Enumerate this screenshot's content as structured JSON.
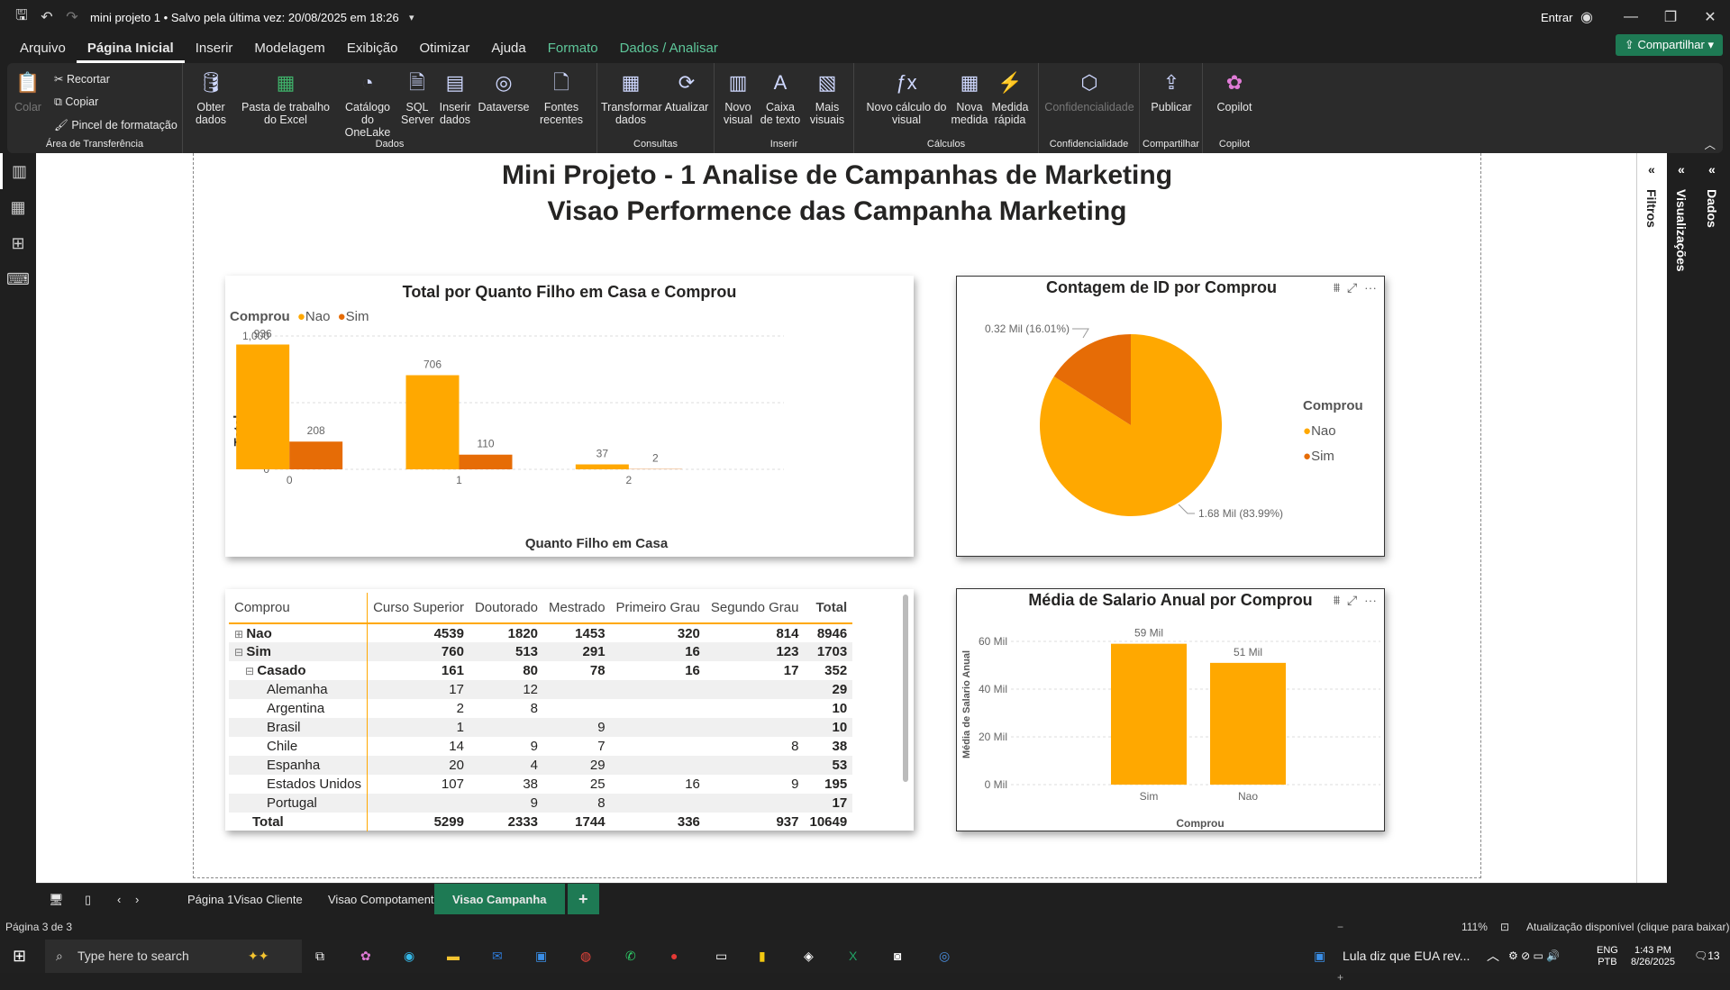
{
  "window": {
    "title": "mini projeto 1 • Salvo pela última vez: 20/08/2025 em 18:26",
    "signin": "Entrar"
  },
  "menu": [
    "Arquivo",
    "Página Inicial",
    "Inserir",
    "Modelagem",
    "Exibição",
    "Otimizar",
    "Ajuda",
    "Formato",
    "Dados / Analisar"
  ],
  "share": "Compartilhar",
  "ribbon": {
    "clipboard": {
      "colar": "Colar",
      "recortar": "Recortar",
      "copiar": "Copiar",
      "pincel": "Pincel de formatação",
      "label": "Área de Transferência"
    },
    "dados": {
      "items": [
        "Obter dados",
        "Pasta de trabalho do Excel",
        "Catálogo do OneLake",
        "SQL Server",
        "Inserir dados",
        "Dataverse",
        "Fontes recentes"
      ],
      "label": "Dados"
    },
    "consultas": {
      "items": [
        "Transformar dados",
        "Atualizar"
      ],
      "label": "Consultas"
    },
    "inserir": {
      "items": [
        "Novo visual",
        "Caixa de texto",
        "Mais visuais"
      ],
      "label": "Inserir"
    },
    "calculos": {
      "items": [
        "Novo cálculo do visual",
        "Nova medida",
        "Medida rápida"
      ],
      "label": "Cálculos"
    },
    "conf": {
      "items": [
        "Confidencialidade"
      ],
      "label": "Confidencialidade"
    },
    "compart": {
      "items": [
        "Publicar"
      ],
      "label": "Compartilhar"
    },
    "copilot": {
      "items": [
        "Copilot"
      ],
      "label": "Copilot"
    }
  },
  "report": {
    "title1": "Mini Projeto - 1 Analise de Campanhas  de Marketing",
    "title2": "Visao Performence  das Campanha Marketing"
  },
  "panes": {
    "filtros": "Filtros",
    "visualizacoes": "Visualizações",
    "dados": "Dados"
  },
  "bar1": {
    "title": "Total por Quanto Filho em Casa e Comprou",
    "legend_title": "Comprou",
    "xlabel": "Quanto Filho em Casa",
    "ylabel": "Total",
    "ticks": [
      "0",
      "500",
      "1,000"
    ]
  },
  "pie": {
    "title": "Contagem de ID por Comprou",
    "legend_title": "Comprou",
    "label_sim": "0.32 Mil (16.01%)",
    "label_nao": "1.68 Mil (83.99%)"
  },
  "bar2": {
    "title": "Média de Salario Anual por Comprou",
    "xlabel": "Comprou",
    "ylabel": "Média de Salario Anual",
    "ticks": [
      "0 Mil",
      "20 Mil",
      "40 Mil",
      "60 Mil"
    ]
  },
  "chart_data": [
    {
      "type": "bar",
      "title": "Total por Quanto Filho em Casa e Comprou",
      "xlabel": "Quanto Filho em Casa",
      "ylabel": "Total",
      "categories": [
        "0",
        "1",
        "2"
      ],
      "series": [
        {
          "name": "Nao",
          "values": [
            936,
            706,
            37
          ],
          "color": "#FFA800"
        },
        {
          "name": "Sim",
          "values": [
            208,
            110,
            2
          ],
          "color": "#E66C06"
        }
      ],
      "ylim": [
        0,
        1000
      ],
      "legend": "top-left",
      "grid": true
    },
    {
      "type": "pie",
      "title": "Contagem de ID por Comprou",
      "series": [
        {
          "name": "Nao",
          "value": 1680,
          "label": "1.68 Mil (83.99%)",
          "percent": 83.99,
          "color": "#FFA800"
        },
        {
          "name": "Sim",
          "value": 320,
          "label": "0.32 Mil (16.01%)",
          "percent": 16.01,
          "color": "#E66C06"
        }
      ],
      "legend": "right"
    },
    {
      "type": "bar",
      "title": "Média de Salario Anual por Comprou",
      "xlabel": "Comprou",
      "ylabel": "Média de Salario Anual",
      "categories": [
        "Sim",
        "Nao"
      ],
      "values": [
        59,
        51
      ],
      "value_labels": [
        "59 Mil",
        "51 Mil"
      ],
      "ylim": [
        0,
        60
      ],
      "color": "#FFA800",
      "grid": true
    }
  ],
  "matrix": {
    "headers": [
      "Comprou",
      "Curso Superior",
      "Doutorado",
      "Mestrado",
      "Primeiro Grau",
      "Segundo Grau",
      "Total"
    ],
    "rows": [
      {
        "label": "Nao",
        "level": 0,
        "expander": "⊞",
        "bold": true,
        "cells": [
          "4539",
          "1820",
          "1453",
          "320",
          "814",
          "8946"
        ]
      },
      {
        "label": "Sim",
        "level": 0,
        "expander": "⊟",
        "bold": true,
        "cells": [
          "760",
          "513",
          "291",
          "16",
          "123",
          "1703"
        ]
      },
      {
        "label": "Casado",
        "level": 1,
        "expander": "⊟",
        "bold": true,
        "cells": [
          "161",
          "80",
          "78",
          "16",
          "17",
          "352"
        ]
      },
      {
        "label": "Alemanha",
        "level": 2,
        "cells": [
          "17",
          "12",
          "",
          "",
          "",
          "29"
        ]
      },
      {
        "label": "Argentina",
        "level": 2,
        "cells": [
          "2",
          "8",
          "",
          "",
          "",
          "10"
        ]
      },
      {
        "label": "Brasil",
        "level": 2,
        "cells": [
          "1",
          "",
          "9",
          "",
          "",
          "10"
        ]
      },
      {
        "label": "Chile",
        "level": 2,
        "cells": [
          "14",
          "9",
          "7",
          "",
          "8",
          "38"
        ]
      },
      {
        "label": "Espanha",
        "level": 2,
        "cells": [
          "20",
          "4",
          "29",
          "",
          "",
          "53"
        ]
      },
      {
        "label": "Estados Unidos",
        "level": 2,
        "cells": [
          "107",
          "38",
          "25",
          "16",
          "9",
          "195"
        ]
      },
      {
        "label": "Portugal",
        "level": 2,
        "cells": [
          "",
          "9",
          "8",
          "",
          "",
          "17"
        ]
      }
    ],
    "total": {
      "label": "Total",
      "cells": [
        "5299",
        "2333",
        "1744",
        "336",
        "937",
        "10649"
      ]
    }
  },
  "tabs": [
    "Página 1Visao Cliente",
    "Visao Compotamental",
    "Visao Campanha"
  ],
  "status": {
    "page": "Página 3 de 3",
    "zoom": "111%",
    "update": "Atualização disponível (clique para baixar)"
  },
  "taskbar": {
    "search": "Type here to search",
    "news": "Lula diz que EUA rev...",
    "lang": "ENG",
    "lang2": "PTB",
    "time": "1:43 PM",
    "date": "8/26/2025",
    "notif": "13"
  }
}
